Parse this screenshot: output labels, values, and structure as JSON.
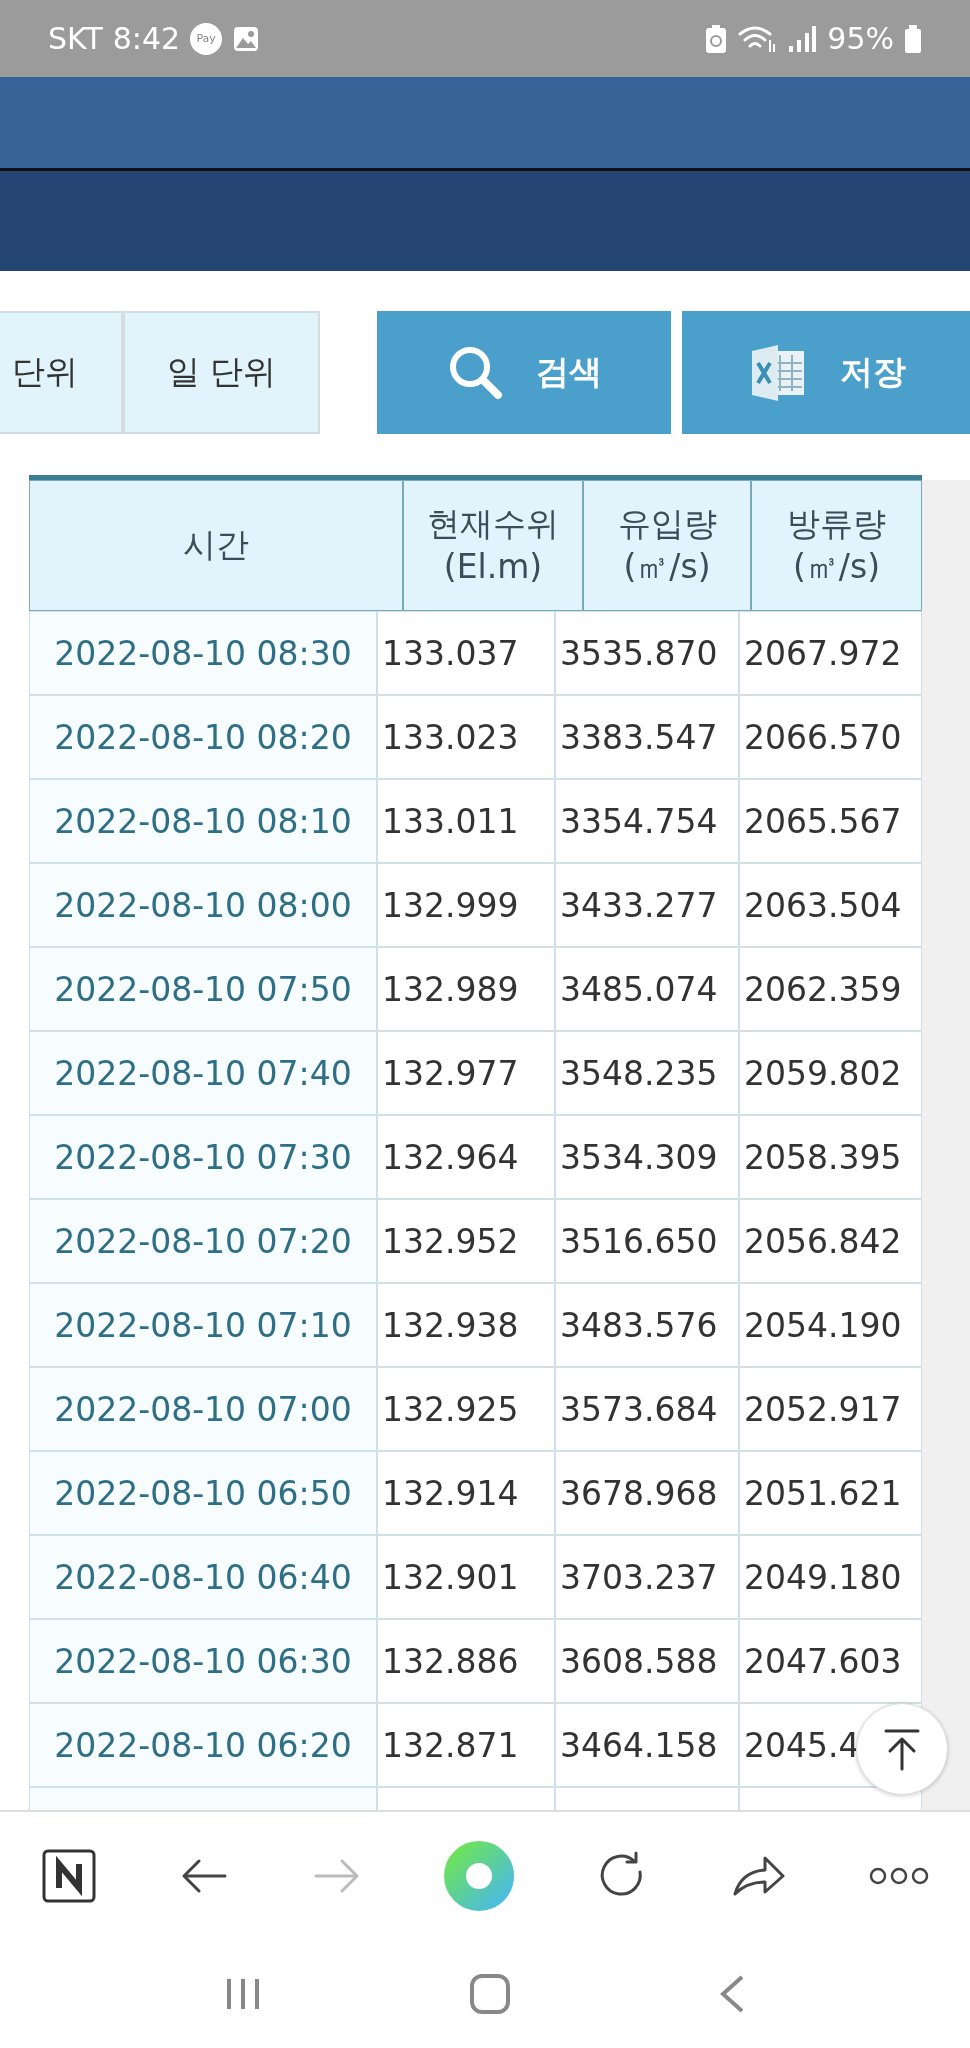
{
  "status_bar": {
    "carrier": "SKT",
    "time": "8:42",
    "pay_badge": "Pay",
    "battery": "95%"
  },
  "period_tabs": [
    {
      "label": "단위"
    },
    {
      "label": "일 단위"
    }
  ],
  "actions": [
    {
      "kind": "search",
      "label": "검색"
    },
    {
      "kind": "excel",
      "label": "저장"
    }
  ],
  "table": {
    "columns": [
      {
        "label": "시간"
      },
      {
        "label": "현재수위",
        "unit": "(El.m)"
      },
      {
        "label": "유입량",
        "unit": "(㎥/s)"
      },
      {
        "label": "방류량",
        "unit": "(㎥/s)"
      }
    ],
    "rows": [
      [
        "2022-08-10 08:30",
        "133.037",
        "3535.870",
        "2067.972"
      ],
      [
        "2022-08-10 08:20",
        "133.023",
        "3383.547",
        "2066.570"
      ],
      [
        "2022-08-10 08:10",
        "133.011",
        "3354.754",
        "2065.567"
      ],
      [
        "2022-08-10 08:00",
        "132.999",
        "3433.277",
        "2063.504"
      ],
      [
        "2022-08-10 07:50",
        "132.989",
        "3485.074",
        "2062.359"
      ],
      [
        "2022-08-10 07:40",
        "132.977",
        "3548.235",
        "2059.802"
      ],
      [
        "2022-08-10 07:30",
        "132.964",
        "3534.309",
        "2058.395"
      ],
      [
        "2022-08-10 07:20",
        "132.952",
        "3516.650",
        "2056.842"
      ],
      [
        "2022-08-10 07:10",
        "132.938",
        "3483.576",
        "2054.190"
      ],
      [
        "2022-08-10 07:00",
        "132.925",
        "3573.684",
        "2052.917"
      ],
      [
        "2022-08-10 06:50",
        "132.914",
        "3678.968",
        "2051.621"
      ],
      [
        "2022-08-10 06:40",
        "132.901",
        "3703.237",
        "2049.180"
      ],
      [
        "2022-08-10 06:30",
        "132.886",
        "3608.588",
        "2047.603"
      ],
      [
        "2022-08-10 06:20",
        "132.871",
        "3464.158",
        "2045.4"
      ]
    ]
  },
  "browser_toolbar": {
    "forward_disabled": true
  }
}
